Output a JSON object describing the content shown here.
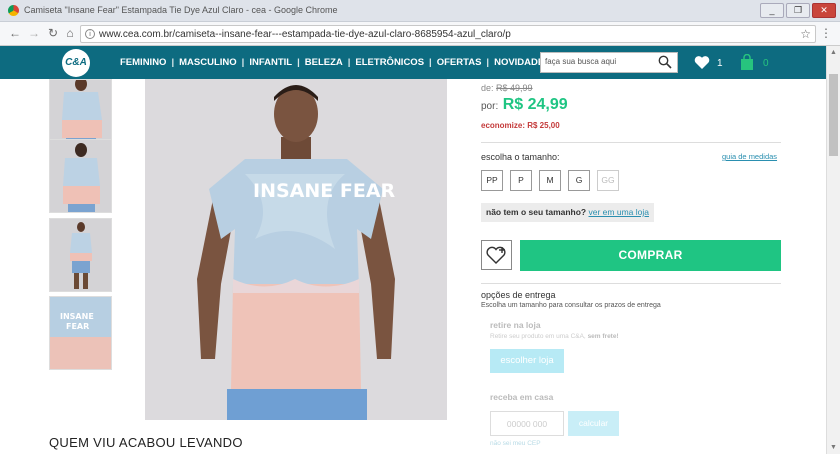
{
  "browser": {
    "title": "Camiseta \"Insane Fear\" Estampada Tie Dye Azul Claro - cea - Google Chrome",
    "url": "www.cea.com.br/camiseta--insane-fear---estampada-tie-dye-azul-claro-8685954-azul_claro/p",
    "info_icon": "i"
  },
  "site": {
    "logo": "C&A",
    "nav": [
      "FEMININO",
      "MASCULINO",
      "INFANTIL",
      "BELEZA",
      "ELETRÔNICOS",
      "OFERTAS",
      "NOVIDADES"
    ],
    "search_placeholder": "faça sua busca aqui",
    "wishlist_count": "1",
    "bag_count": "0",
    "brand_color": "#0d6b80",
    "accent_color": "#1fc583"
  },
  "product": {
    "graphic_text": "INSANE FEAR",
    "old_price_prefix": "de:",
    "old_price": "R$ 49,99",
    "price_prefix": "por:",
    "price": "R$ 24,99",
    "savings": "economize: R$ 25,00",
    "size_label": "escolha o tamanho:",
    "size_guide": "guia de medidas",
    "sizes": [
      "PP",
      "P",
      "M",
      "G",
      "GG"
    ],
    "no_size_text": "não tem o seu tamanho?",
    "no_size_link": "ver em uma loja",
    "buy_label": "COMPRAR"
  },
  "delivery": {
    "title": "opções de entrega",
    "subtitle": "Escolha um tamanho para consultar os prazos de entrega",
    "pickup_title": "retire na loja",
    "pickup_sub": "Retire seu produto em uma C&A,",
    "pickup_sub_bold": "sem frete!",
    "pickup_button": "escolher loja",
    "receive_title": "receba em casa",
    "cep_placeholder": "00000 000",
    "calc_button": "calcular",
    "no_cep": "não sei meu CEP"
  },
  "section_heading": "QUEM VIU ACABOU LEVANDO"
}
